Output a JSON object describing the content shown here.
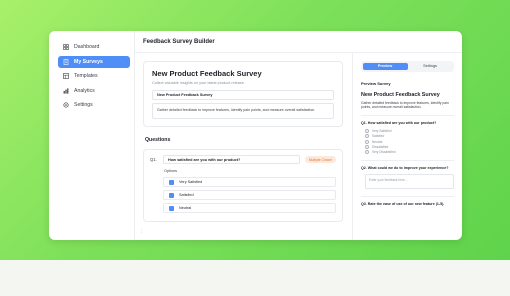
{
  "sidebar": {
    "items": [
      {
        "label": "Dashboard",
        "icon": "dashboard-icon",
        "active": false
      },
      {
        "label": "My Surveys",
        "icon": "document-icon",
        "active": true
      },
      {
        "label": "Templates",
        "icon": "template-icon",
        "active": false
      },
      {
        "label": "Analytics",
        "icon": "chart-icon",
        "active": false
      },
      {
        "label": "Settings",
        "icon": "gear-icon",
        "active": false
      }
    ]
  },
  "header": {
    "title": "Feedback Survey Builder"
  },
  "editor": {
    "survey_title": "New Product Feedback Survey",
    "survey_subtitle": "Collect valuable insights on your latest product release.",
    "title_field_value": "New Product Feedback Survey",
    "description_value": "Gather detailed feedback to improve features, identify pain points, and measure overall satisfaction.",
    "questions_label": "Questions",
    "question": {
      "number": "Q1.",
      "text": "How satisfied are you with our product?",
      "type_badge": "Multiple Choice",
      "options_label": "Options",
      "options": [
        "Very Satisfied",
        "Satisfied",
        "Neutral"
      ]
    }
  },
  "preview": {
    "tabs": [
      "Preview",
      "Settings"
    ],
    "active_tab": "Preview",
    "label": "Preview Survey",
    "title": "New Product Feedback Survey",
    "subtitle": "Gather detailed feedback to improve features, identify pain points, and measure overall satisfaction.",
    "q1": {
      "text": "Q1. How satisfied are you with our product?",
      "options": [
        "Very Satisfied",
        "Satisfied",
        "Neutral",
        "Dissatisfied",
        "Very Dissatisfied"
      ]
    },
    "q2": {
      "text": "Q2. What could we do to improve your experience?",
      "placeholder": "Enter your feedback here..."
    },
    "q3": {
      "text": "Q3. Rate the ease of use of our new feature (1-5)."
    }
  },
  "colors": {
    "accent": "#4f8ef7",
    "badge_bg": "#fde9dc",
    "badge_text": "#e07a3a",
    "background": "#7ee05a"
  }
}
